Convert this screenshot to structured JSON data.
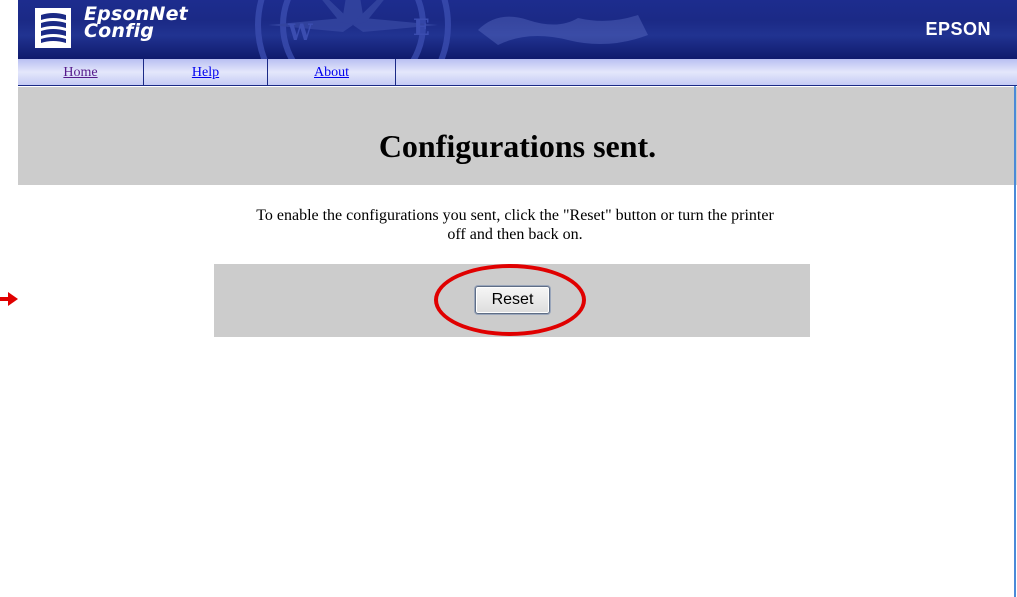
{
  "header": {
    "app_name_line1": "EpsonNet",
    "app_name_line2": "Config",
    "brand": "EPSON"
  },
  "nav": {
    "items": [
      {
        "label": "Home",
        "icon": "link"
      },
      {
        "label": "Help",
        "icon": "link"
      },
      {
        "label": "About",
        "icon": "link"
      }
    ]
  },
  "main": {
    "title": "Configurations sent.",
    "message_line1": "To enable the configurations you sent, click the \"Reset\" button or turn the printer",
    "message_line2": "off and then back on.",
    "reset_label": "Reset"
  },
  "annotations": {
    "highlight_color": "#e00000",
    "highlight_icon": "red-circle-icon",
    "arrow_icon": "red-arrow-icon"
  },
  "colors": {
    "banner": "#1b2a86",
    "navbar": "#d4d8f8",
    "panel": "#cccccc",
    "visited_link": "#551a8b",
    "link": "#0000ee"
  }
}
